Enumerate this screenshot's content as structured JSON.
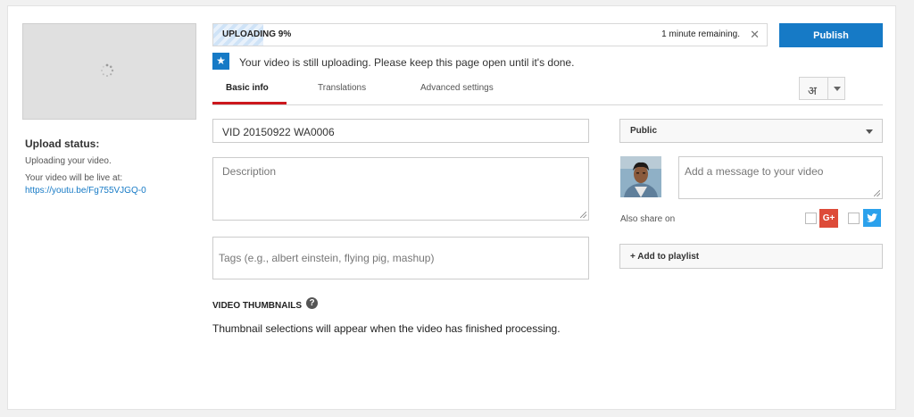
{
  "left_panel": {
    "status_title": "Upload status:",
    "status_text": "Uploading your video.",
    "live_label": "Your video will be live at:",
    "live_link": "https://youtu.be/Fg755VJGQ-0"
  },
  "progress": {
    "label": "UPLOADING 9%",
    "percent": 9,
    "remaining": "1 minute remaining.",
    "close_icon": "close-icon"
  },
  "publish_label": "Publish",
  "notice": {
    "icon": "star-icon",
    "text": "Your video is still uploading. Please keep this page open until it's done."
  },
  "tabs": [
    {
      "label": "Basic info",
      "active": true
    },
    {
      "label": "Translations",
      "active": false
    },
    {
      "label": "Advanced settings",
      "active": false
    }
  ],
  "language_button": {
    "glyph": "अ"
  },
  "form": {
    "title_value": "VID 20150922 WA0006",
    "description_placeholder": "Description",
    "tags_placeholder": "Tags (e.g., albert einstein, flying pig, mashup)"
  },
  "thumbnails": {
    "title": "VIDEO THUMBNAILS",
    "help_glyph": "?",
    "text": "Thumbnail selections will appear when the video has finished processing."
  },
  "right_panel": {
    "privacy_value": "Public",
    "message_placeholder": "Add a message to your video",
    "share_label": "Also share on",
    "gplus_label": "G+",
    "playlist_label": "+ Add to playlist"
  },
  "colors": {
    "accent": "#167ac6",
    "tab_underline": "#cc181e",
    "gplus": "#dd4b39",
    "twitter": "#2ba1ec"
  }
}
